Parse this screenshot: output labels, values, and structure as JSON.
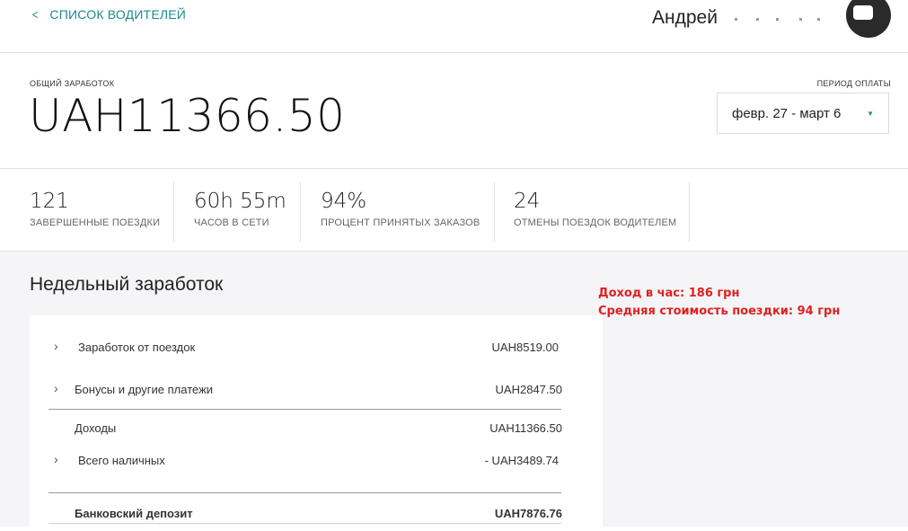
{
  "header": {
    "back_label": "СПИСОК ВОДИТЕЛЕЙ",
    "driver_name": "Андрей"
  },
  "earnings": {
    "total_label": "ОБЩИЙ ЗАРАБОТОК",
    "total_value": "UAH11366.50",
    "period_label": "ПЕРИОД ОПЛАТЫ",
    "period_value": "февр. 27 - март 6"
  },
  "stats": [
    {
      "value": "121",
      "label": "ЗАВЕРШЕННЫЕ ПОЕЗДКИ"
    },
    {
      "value": "60h 55m",
      "label": "ЧАСОВ В СЕТИ"
    },
    {
      "value": "94%",
      "label": "ПРОЦЕНТ ПРИНЯТЫХ ЗАКАЗОВ"
    },
    {
      "value": "24",
      "label": "ОТМЕНЫ ПОЕЗДОК ВОДИТЕЛЕМ"
    }
  ],
  "weekly": {
    "title": "Недельный заработок",
    "rows": [
      {
        "label": "Заработок от поездок",
        "value": "UAH8519.00"
      },
      {
        "label": "Бонусы и другие платежи",
        "value": "UAH2847.50"
      },
      {
        "label": "Доходы",
        "value": "UAH11366.50"
      },
      {
        "label": "Всего наличных",
        "value": "- UAH3489.74"
      },
      {
        "label": "Банковский депозит",
        "value": "UAH7876.76"
      }
    ]
  },
  "annotation": {
    "line1": "Доход в час: 186 грн",
    "line2": "Средняя стоимость поездки: 94 грн"
  },
  "colors": {
    "accent": "#1b8a8f",
    "annotation": "#e02020"
  }
}
